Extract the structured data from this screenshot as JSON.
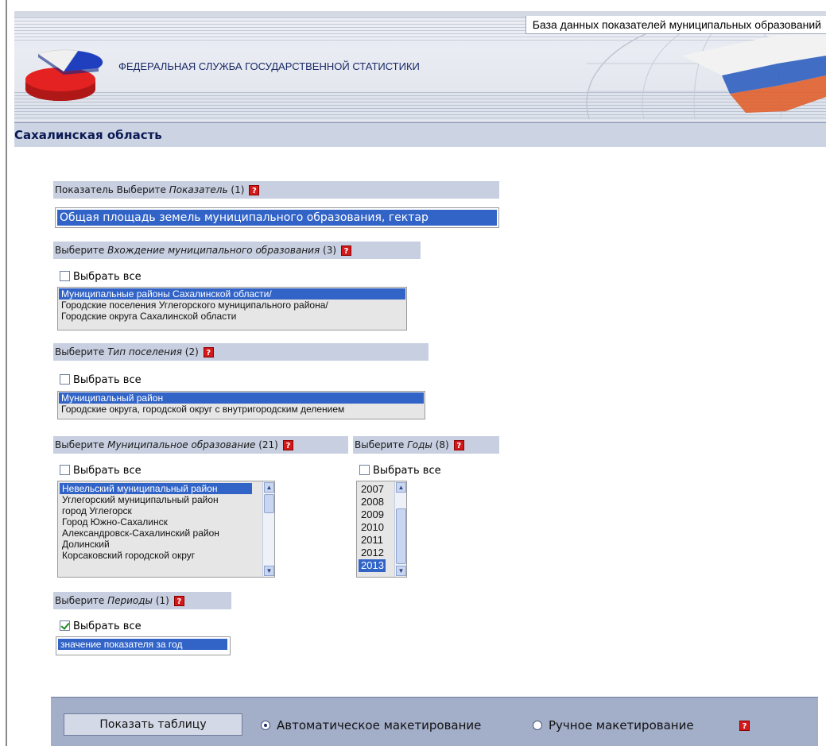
{
  "header": {
    "db_title": "База данных показателей муниципальных образований",
    "agency": "ФЕДЕРАЛЬНАЯ СЛУЖБА ГОСУДАРСТВЕННОЙ СТАТИСТИКИ"
  },
  "region": "Сахалинская область",
  "indicator": {
    "prefix": "Показатель Выберите ",
    "label": "Показатель",
    "count": "(1)",
    "selected": "Общая площадь земель муниципального образования, гектар"
  },
  "membership": {
    "prefix": "Выберите ",
    "label": "Вхождение муниципального образования",
    "count": "(3)",
    "select_all": "Выбрать все",
    "options": [
      "Муниципальные районы Сахалинской области/",
      "Городские поселения Углегорского муниципального района/",
      "Городские округа Сахалинской области"
    ]
  },
  "settlement_type": {
    "prefix": "Выберите ",
    "label": "Тип поселения",
    "count": "(2)",
    "select_all": "Выбрать все",
    "options": [
      "Муниципальный район",
      "Городские округа, городской округ с внутригородским делением"
    ]
  },
  "municipality": {
    "prefix": "Выберите ",
    "label": "Муниципальное образование",
    "count": "(21)",
    "select_all": "Выбрать все",
    "options": [
      "Невельский муниципальный район",
      "Углегорский муниципальный район",
      "город Углегорск",
      "Город Южно-Сахалинск",
      "Александровск-Сахалинский район",
      "Долинский",
      "Корсаковский городской округ"
    ]
  },
  "years": {
    "prefix": "Выберите ",
    "label": "Годы",
    "count": "(8)",
    "select_all": "Выбрать все",
    "options": [
      "2007",
      "2008",
      "2009",
      "2010",
      "2011",
      "2012",
      "2013"
    ]
  },
  "periods": {
    "prefix": "Выберите ",
    "label": "Периоды",
    "count": "(1)",
    "select_all": "Выбрать все",
    "selected": "значение показателя за год"
  },
  "help_glyph": "?",
  "bottom": {
    "show_table": "Показать таблицу",
    "auto_layout": "Автоматическое макетирование",
    "manual_layout": "Ручное макетирование"
  },
  "colors": {
    "selection": "#3264c8",
    "section_bg": "#c7cfe0",
    "bottom_bar": "#a3aec9",
    "help_red": "#d21a1a"
  }
}
